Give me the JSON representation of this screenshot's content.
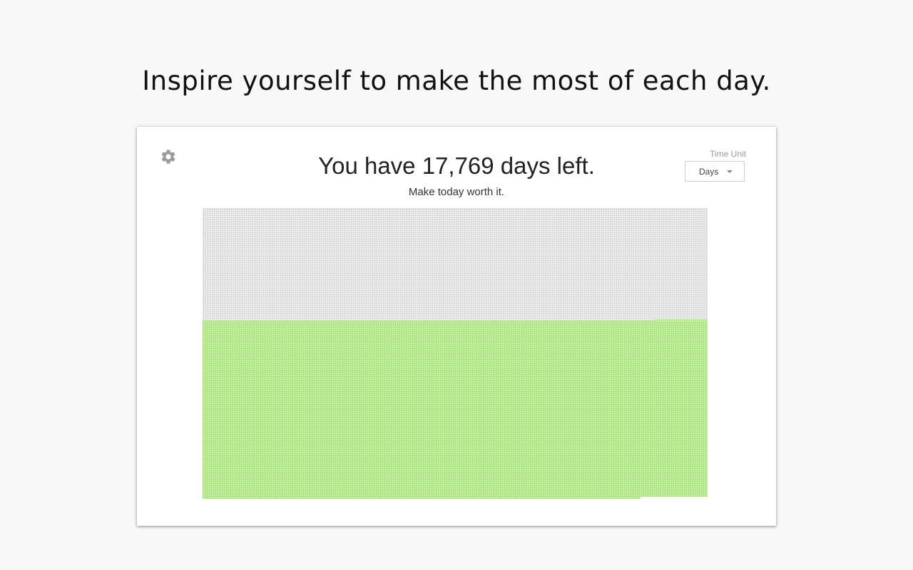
{
  "tagline": "Inspire yourself to make the most of each day.",
  "header": {
    "headline": "You have 17,769 days left.",
    "subline": "Make today worth it."
  },
  "time_unit": {
    "label": "Time Unit",
    "selected": "Days"
  },
  "icons": {
    "settings": "gear-icon",
    "dropdown": "caret-down-icon"
  },
  "colors": {
    "remaining": "#a9e27f",
    "lived": "#d9d9d9"
  }
}
